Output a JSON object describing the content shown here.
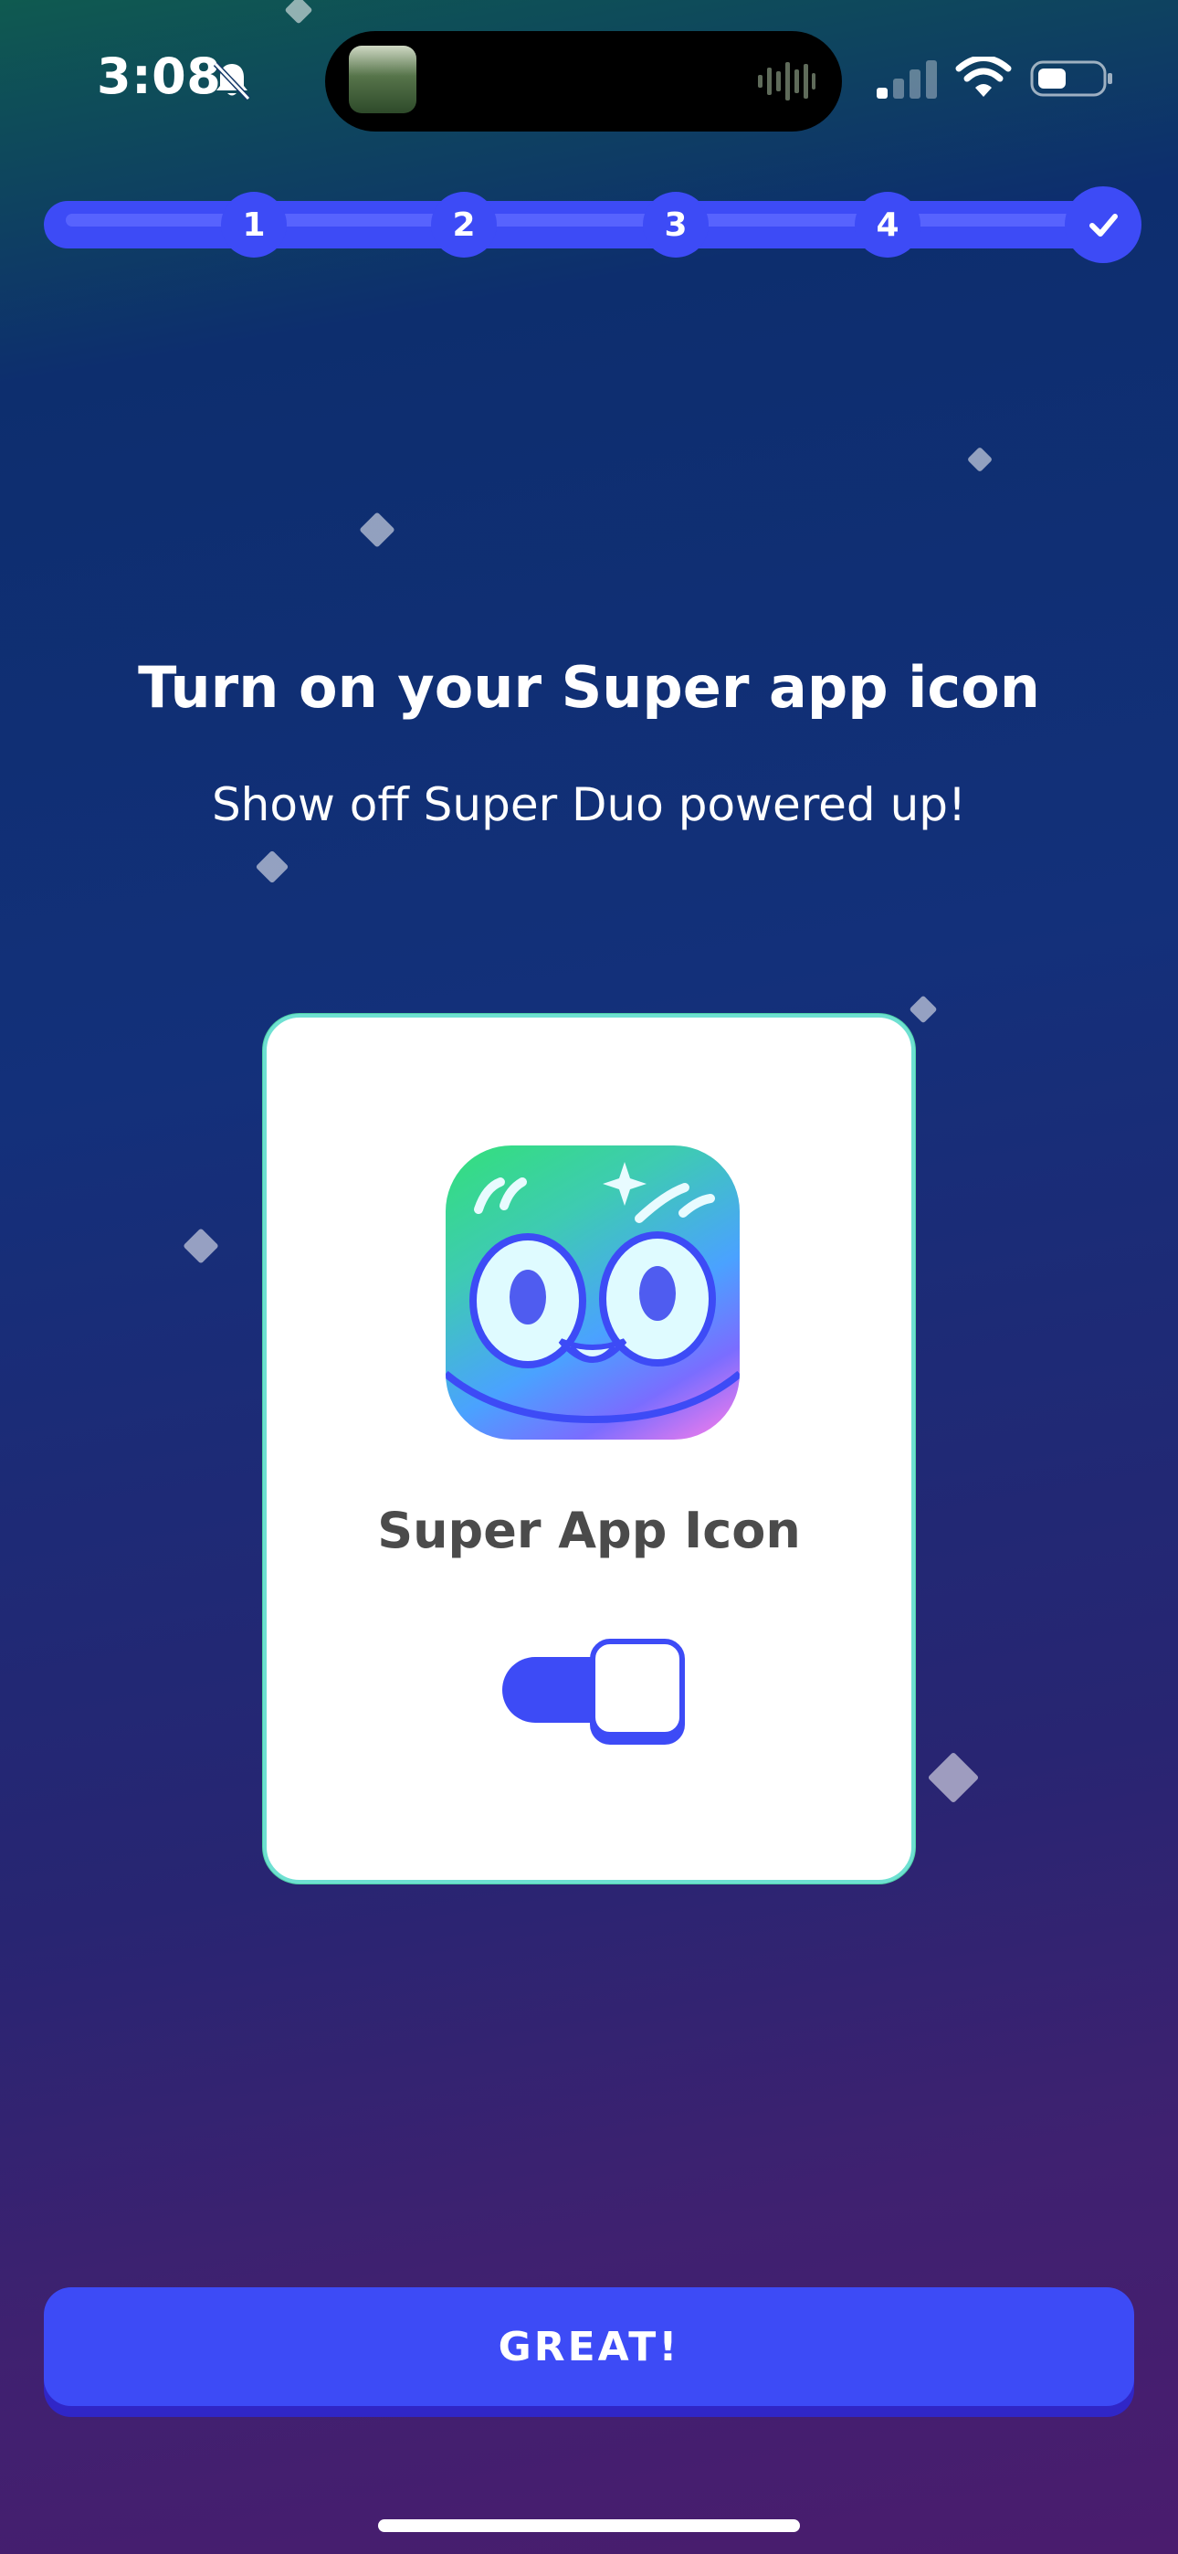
{
  "status_bar": {
    "time": "3:08",
    "icons": [
      "bell-slash-icon",
      "cellular-signal-icon",
      "wifi-icon",
      "battery-icon"
    ]
  },
  "progress": {
    "steps": [
      "1",
      "2",
      "3",
      "4"
    ],
    "completed": true,
    "final_step_icon": "checkmark-icon"
  },
  "title": "Turn on your Super app icon",
  "subtitle": "Show off Super Duo powered up!",
  "card": {
    "label": "Super App Icon",
    "toggle_on": true
  },
  "button": {
    "label": "GREAT!"
  },
  "colors": {
    "accent": "#3D4BF6",
    "button_shadow": "#3026C7",
    "card_border": "#6EE0D2"
  }
}
